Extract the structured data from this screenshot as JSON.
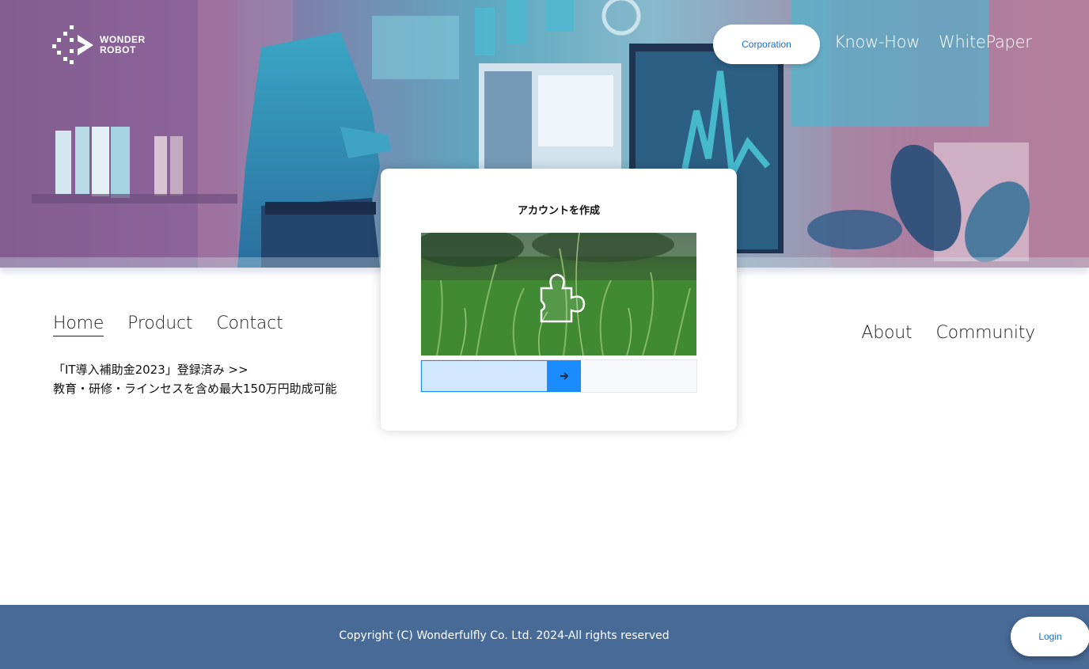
{
  "logo": {
    "line1": "WONDER",
    "line2": "ROBOT"
  },
  "top_nav": {
    "corporation": "Corporation",
    "know_how": "Know-How",
    "white_paper": "WhitePaper"
  },
  "main_nav": {
    "left": [
      "Home",
      "Product",
      "Contact"
    ],
    "right": [
      "About",
      "Community"
    ],
    "active": "Home"
  },
  "subsidy": {
    "line1": "「IT導入補助金2023」登録済み >>",
    "line2": "教育・研修・ラインセスを含め最大150万円助成可能"
  },
  "captcha": {
    "title": "アカウントを作成",
    "progress": 0.46
  },
  "footer": {
    "copyright": "Copyright (C) Wonderfulfly Co. Ltd. 2024-All rights reserved",
    "login": "Login"
  },
  "colors": {
    "accent": "#1a8cff",
    "footer_bg": "#486a96",
    "link_blue": "#1b6fd1"
  }
}
